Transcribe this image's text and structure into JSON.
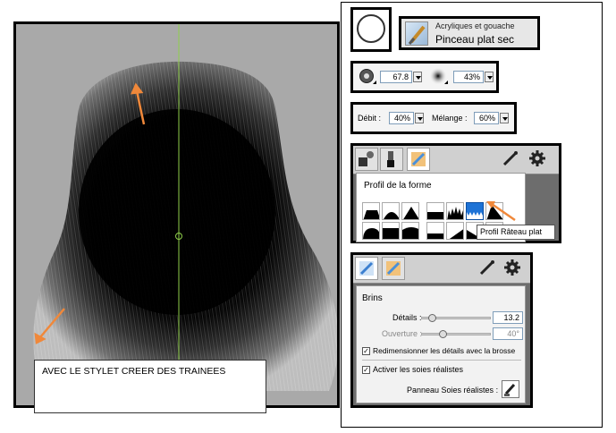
{
  "canvas": {
    "caption": "AVEC LE STYLET CREER DES TRAINEES"
  },
  "variant": {
    "category": "Acryliques et gouache",
    "name": "Pinceau plat sec"
  },
  "size": {
    "value": "67.8",
    "opacity": "43%"
  },
  "flow": {
    "debit_label": "Débit :",
    "debit_value": "40%",
    "melange_label": "Mélange :",
    "melange_value": "60%"
  },
  "profile": {
    "title": "Profil de la forme",
    "tooltip": "Profil Râteau plat"
  },
  "bristles": {
    "title": "Brins",
    "details_label": "Détails :",
    "details_value": "13.2",
    "details_level": 0.15,
    "ouverture_label": "Ouverture :",
    "ouverture_value": "40°",
    "ouverture_level": 0.3,
    "resize_label": "Redimensionner les détails avec la brosse",
    "resize_checked": true,
    "realistic_label": "Activer les soies réalistes",
    "realistic_checked": true,
    "panel_label": "Panneau Soies réalistes :"
  },
  "colors": {
    "arrow": "#f0883a",
    "guide": "#8fcf4a",
    "selected": "#1e73d6"
  }
}
